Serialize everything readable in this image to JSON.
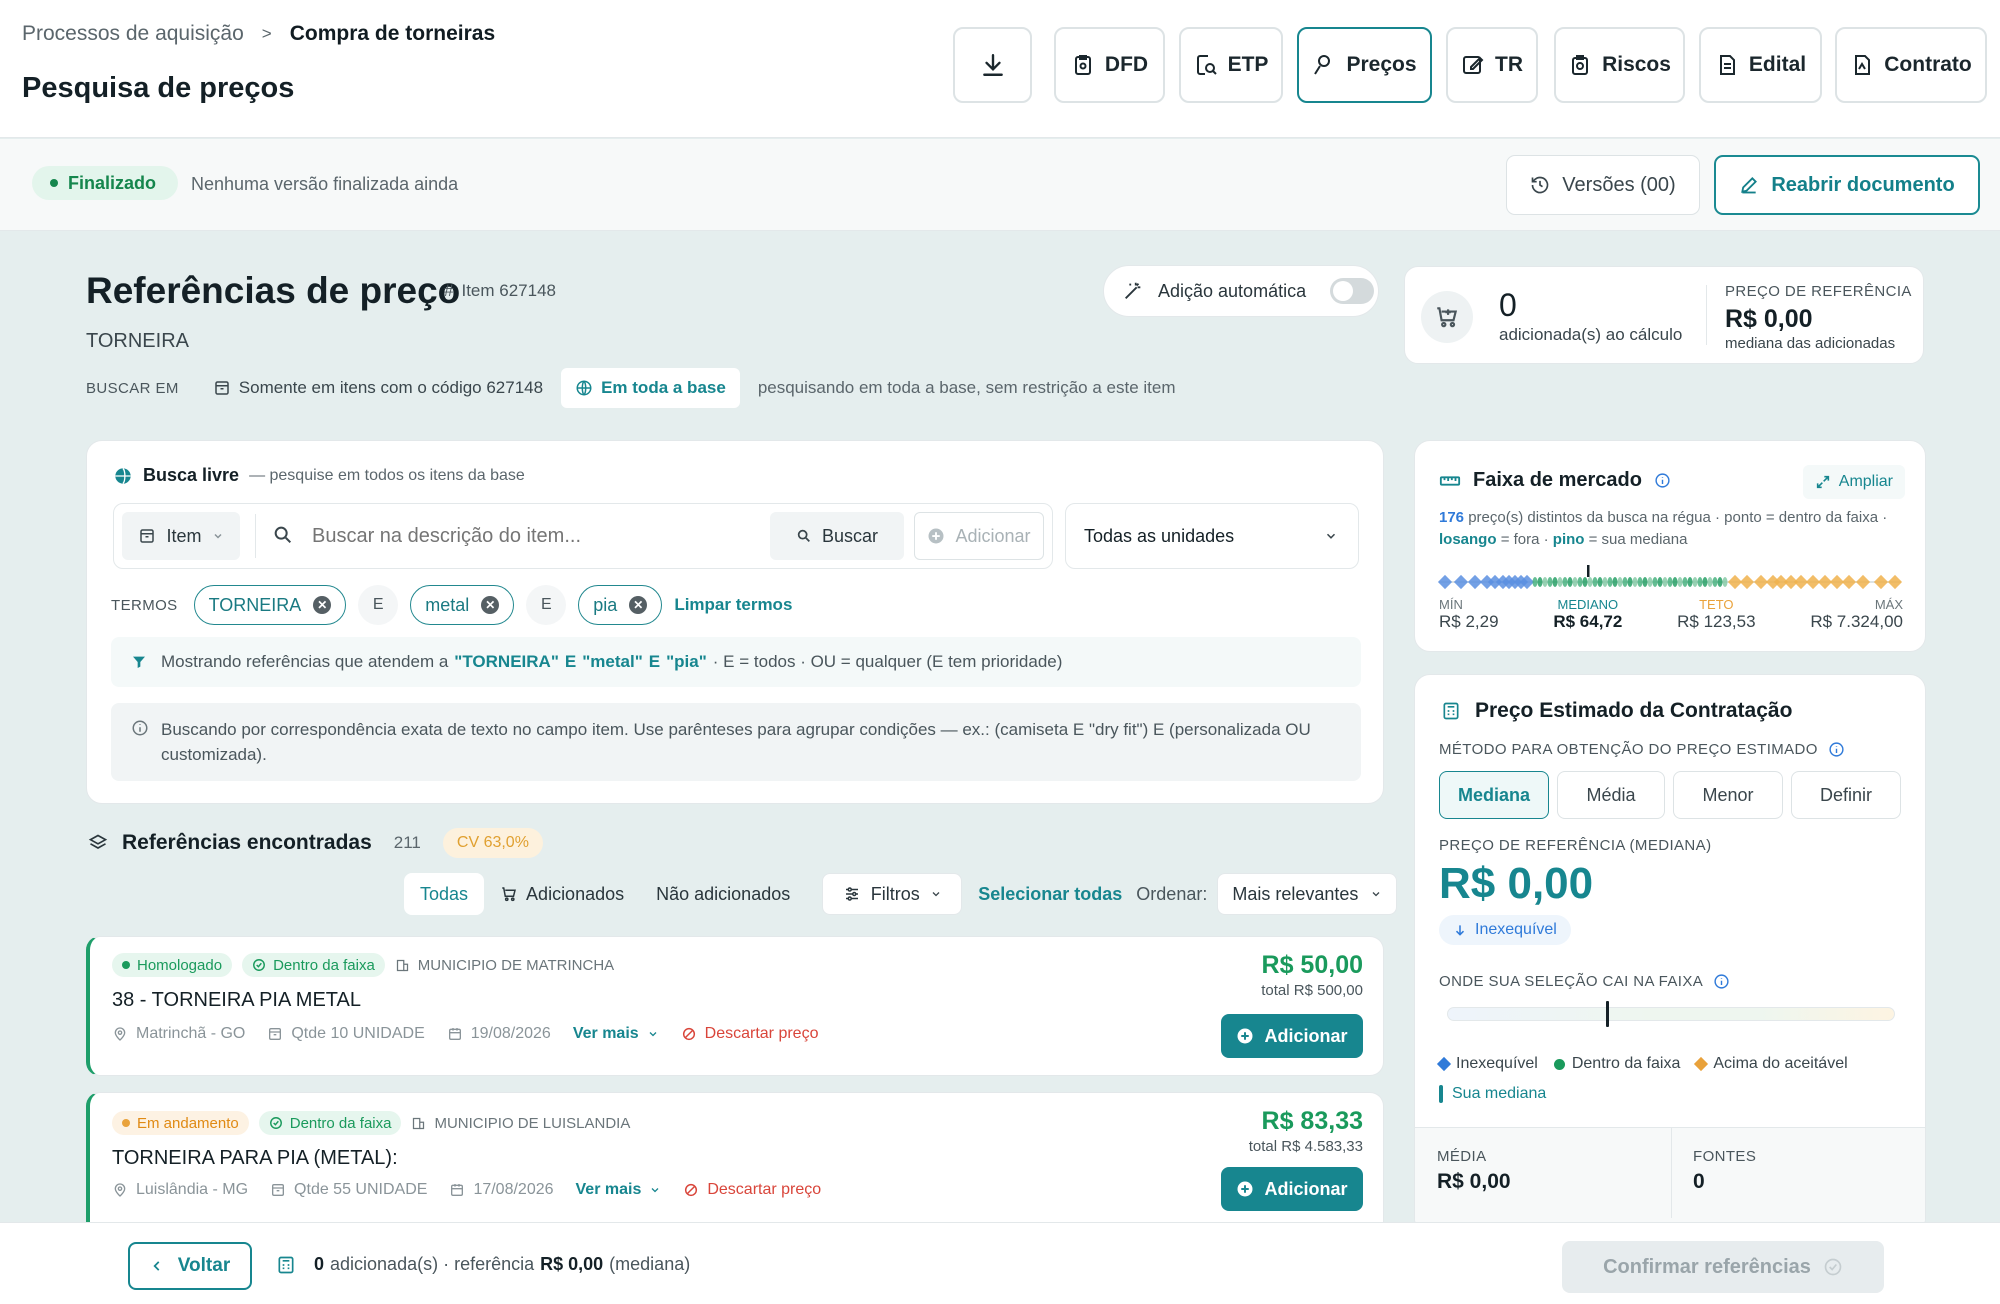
{
  "breadcrumb": {
    "parent": "Processos de aquisição",
    "separator": ">",
    "current": "Compra de torneiras"
  },
  "page_title": "Pesquisa de preços",
  "nav": {
    "download_icon": "download-icon",
    "dfd": "DFD",
    "etp": "ETP",
    "precos": "Preços",
    "tr": "TR",
    "riscos": "Riscos",
    "edital": "Edital",
    "contrato": "Contrato"
  },
  "status": {
    "badge": "Finalizado",
    "note": "Nenhuma versão finalizada ainda",
    "versions": "Versões (00)",
    "reopen": "Reabrir documento"
  },
  "refs": {
    "title": "Referências de preço",
    "item_tag": "Item 627148",
    "item_hash": "#",
    "item_name": "TORNEIRA",
    "auto_add": "Adição automática",
    "search_in_label": "BUSCAR EM",
    "scope_code": "Somente em itens com o código 627148",
    "scope_all": "Em toda a base",
    "scope_note": "pesquisando em toda a base, sem restrição a este item"
  },
  "calc": {
    "count": "0",
    "count_label": "adicionada(s) ao cálculo",
    "ref_label": "PREÇO DE REFERÊNCIA",
    "ref_value": "R$ 0,00",
    "ref_sub": "mediana das adicionadas"
  },
  "free": {
    "title": "Busca livre",
    "subtitle": "— pesquise em todos os itens da base",
    "field_select": "Item",
    "placeholder": "Buscar na descrição do item...",
    "search_btn": "Buscar",
    "add_btn": "Adicionar",
    "units": "Todas as unidades",
    "terms_label": "TERMOS",
    "terms": [
      "TORNEIRA",
      "metal",
      "pia"
    ],
    "connector": "E",
    "clear": "Limpar termos",
    "filter_pre": "Mostrando referências que atendem a",
    "filter_q1": "\"TORNEIRA\"",
    "filter_e1": "E",
    "filter_q2": "\"metal\"",
    "filter_e2": "E",
    "filter_q3": "\"pia\"",
    "filter_post": "· E = todos · OU = qualquer (E tem prioridade)",
    "info": "Buscando por correspondência exata de texto no campo item. Use parênteses para agrupar condições — ex.: (camiseta E \"dry fit\") E (personalizada OU customizada)."
  },
  "found": {
    "title": "Referências encontradas",
    "count": "211",
    "cv": "CV 63,0%",
    "tab_all": "Todas",
    "tab_added": "Adicionados",
    "tab_not_added": "Não adicionados",
    "filters": "Filtros",
    "select_all": "Selecionar todas",
    "order_label": "Ordenar:",
    "order_value": "Mais relevantes"
  },
  "results": [
    {
      "status": "Homologado",
      "status_color": "#1a9a5c",
      "status_bg": "#e6f6ee",
      "band": "Dentro da faixa",
      "org": "MUNICIPIO DE MATRINCHA",
      "title": "38 - TORNEIRA PIA METAL",
      "location": "Matrinchã - GO",
      "qty": "Qtde 10 UNIDADE",
      "date": "19/08/2026",
      "more": "Ver mais",
      "discard": "Descartar preço",
      "price": "R$ 50,00",
      "total": "total R$ 500,00",
      "add": "Adicionar"
    },
    {
      "status": "Em andamento",
      "status_color": "#e08a14",
      "status_bg": "#fdf2e3",
      "band": "Dentro da faixa",
      "org": "MUNICIPIO DE LUISLANDIA",
      "title": "TORNEIRA PARA PIA (METAL):",
      "location": "Luislândia - MG",
      "qty": "Qtde 55 UNIDADE",
      "date": "17/08/2026",
      "more": "Ver mais",
      "discard": "Descartar preço",
      "price": "R$ 83,33",
      "total": "total R$ 4.583,33",
      "add": "Adicionar"
    }
  ],
  "market": {
    "title": "Faixa de mercado",
    "expand": "Ampliar",
    "desc_count": "176",
    "desc_a": "preço(s) distintos da busca na régua · ponto = dentro da faixa ·",
    "desc_losango": "losango",
    "desc_b": "= fora ·",
    "desc_pino": "pino",
    "desc_c": "= sua mediana",
    "min_label": "MÍN",
    "min": "R$ 2,29",
    "median_label": "MEDIANO",
    "median": "R$ 64,72",
    "ceiling_label": "TETO",
    "ceiling": "R$ 123,53",
    "max_label": "MÁX",
    "max": "R$ 7.324,00"
  },
  "estimate": {
    "title": "Preço Estimado da Contratação",
    "method_label": "MÉTODO PARA OBTENÇÃO DO PREÇO ESTIMADO",
    "methods": [
      "Mediana",
      "Média",
      "Menor",
      "Definir"
    ],
    "ref_label": "PREÇO DE REFERÊNCIA (MEDIANA)",
    "ref_value": "R$ 0,00",
    "status": "Inexequível",
    "where_label": "ONDE SUA SELEÇÃO CAI NA FAIXA",
    "legend": [
      "Inexequível",
      "Dentro da faixa",
      "Acima do aceitável",
      "Sua mediana"
    ],
    "avg_label": "MÉDIA",
    "avg": "R$ 0,00",
    "sources_label": "FONTES",
    "sources": "0"
  },
  "footer": {
    "back": "Voltar",
    "count": "0",
    "summary_a": "adicionada(s) · referência",
    "summary_value": "R$ 0,00",
    "summary_b": "(mediana)",
    "confirm": "Confirmar referências"
  },
  "colors": {
    "accent": "#17868f",
    "success": "#1a9a5c",
    "warning": "#e9a23b",
    "danger": "#d9453a",
    "info": "#2f7ad9"
  }
}
